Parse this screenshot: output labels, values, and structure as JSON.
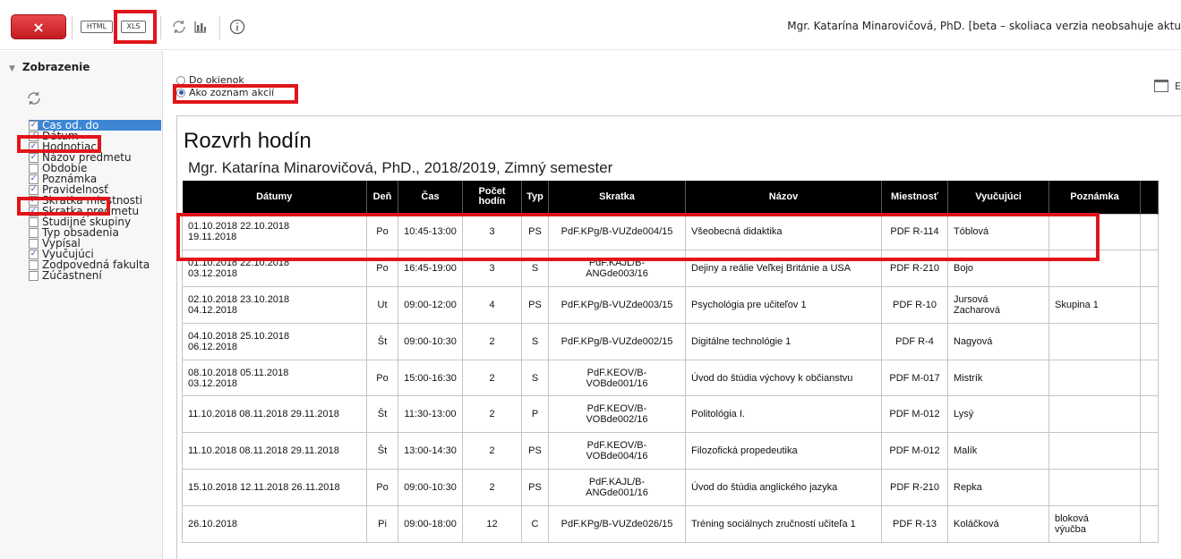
{
  "toolbar": {
    "close_label": "×",
    "html_label": "HTML",
    "xls_label": "XLS",
    "user_info": "Mgr. Katarína Minarovičová, PhD. [beta – skoliaca verzia neobsahuje aktu"
  },
  "left_panel": {
    "title": "Zobrazenie",
    "options": [
      {
        "label": "Čas od. do",
        "checked": true,
        "selected": true
      },
      {
        "label": "Dátum",
        "checked": true
      },
      {
        "label": "Hodnotiaci",
        "checked": true
      },
      {
        "label": "Názov predmetu",
        "checked": true
      },
      {
        "label": "Obdobie",
        "checked": false
      },
      {
        "label": "Poznámka",
        "checked": true
      },
      {
        "label": "Pravidelnosť",
        "checked": true
      },
      {
        "label": "Skratka miestnosti",
        "checked": true
      },
      {
        "label": "Skratka predmetu",
        "checked": true
      },
      {
        "label": "Študijné skupiny",
        "checked": false
      },
      {
        "label": "Typ obsadenia",
        "checked": false
      },
      {
        "label": "Vypísal",
        "checked": false
      },
      {
        "label": "Vyučujúci",
        "checked": true
      },
      {
        "label": "Zodpovedná fakulta",
        "checked": false
      },
      {
        "label": "Zúčastnení",
        "checked": false
      }
    ]
  },
  "view": {
    "radio_windows": "Do okienok",
    "radio_list": "Ako zoznam akcií",
    "selected": "list",
    "cal_letter": "E"
  },
  "report": {
    "title": "Rozvrh hodín",
    "subtitle": "Mgr. Katarína Minarovičová, PhD., 2018/2019, Zimný semester",
    "columns": [
      "Dátumy",
      "Deň",
      "Čas",
      "Počet hodín",
      "Typ",
      "Skratka",
      "Názov",
      "Miestnosť",
      "Vyučujúci",
      "Poznámka"
    ],
    "rows": [
      [
        "01.10.2018  22.10.2018\n19.11.2018",
        "Po",
        "10:45-13:00",
        "3",
        "PS",
        "PdF.KPg/B-VUZde004/15",
        "Všeobecná didaktika",
        "PDF R-114",
        "Tóblová",
        ""
      ],
      [
        "01.10.2018  22.10.2018\n03.12.2018",
        "Po",
        "16:45-19:00",
        "3",
        "S",
        "PdF.KAJL/B-\nANGde003/16",
        "Dejiny a reálie Veľkej Británie a USA",
        "PDF R-210",
        "Bojo",
        ""
      ],
      [
        "02.10.2018  23.10.2018\n04.12.2018",
        "Ut",
        "09:00-12:00",
        "4",
        "PS",
        "PdF.KPg/B-VUZde003/15",
        "Psychológia pre učiteľov 1",
        "PDF R-10",
        "Jursová\nZacharová",
        "Skupina 1"
      ],
      [
        "04.10.2018  25.10.2018\n06.12.2018",
        "Št",
        "09:00-10:30",
        "2",
        "S",
        "PdF.KPg/B-VUZde002/15",
        "Digitálne technológie 1",
        "PDF R-4",
        "Nagyová",
        ""
      ],
      [
        "08.10.2018  05.11.2018\n03.12.2018",
        "Po",
        "15:00-16:30",
        "2",
        "S",
        "PdF.KEOV/B-\nVOBde001/16",
        "Úvod do štúdia výchovy k občianstvu",
        "PDF M-017",
        "Mistrík",
        ""
      ],
      [
        "11.10.2018  08.11.2018  29.11.2018",
        "Št",
        "11:30-13:00",
        "2",
        "P",
        "PdF.KEOV/B-\nVOBde002/16",
        "Politológia I.",
        "PDF M-012",
        "Lysý",
        ""
      ],
      [
        "11.10.2018  08.11.2018  29.11.2018",
        "Št",
        "13:00-14:30",
        "2",
        "PS",
        "PdF.KEOV/B-\nVOBde004/16",
        "Filozofická propedeutika",
        "PDF M-012",
        "Malík",
        ""
      ],
      [
        "15.10.2018  12.11.2018  26.11.2018",
        "Po",
        "09:00-10:30",
        "2",
        "PS",
        "PdF.KAJL/B-\nANGde001/16",
        "Úvod do štúdia anglického jazyka",
        "PDF R-210",
        "Repka",
        ""
      ],
      [
        "26.10.2018",
        "Pi",
        "09:00-18:00",
        "12",
        "C",
        "PdF.KPg/B-VUZde026/15",
        "Tréning sociálnych zručností učiteľa 1",
        "PDF R-13",
        "Koláčková",
        "bloková\nvýučba"
      ]
    ]
  },
  "colors": {
    "close": "#d32a2f",
    "highlight": "#e0151b",
    "selected": "#3c86d4",
    "table_header": "#000000"
  }
}
